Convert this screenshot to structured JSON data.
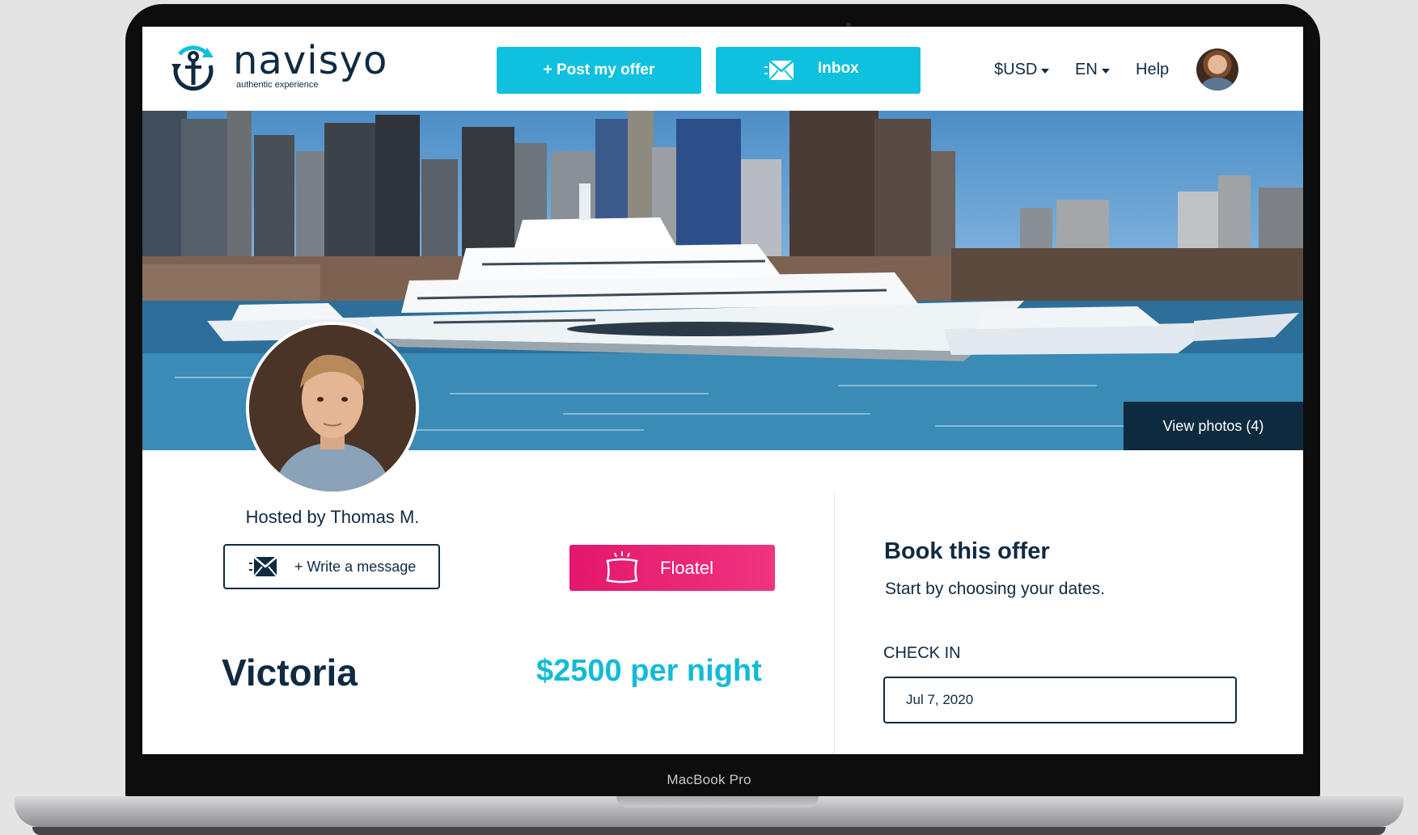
{
  "device": {
    "model_label": "MacBook Pro"
  },
  "brand": {
    "name": "navisyo",
    "tagline": "authentic experience",
    "colors": {
      "navy": "#102a43",
      "cyan": "#0fc1de",
      "pink": "#e3176d"
    }
  },
  "header": {
    "post_offer_label": "+ Post my offer",
    "inbox_label": "Inbox",
    "currency_label": "$USD",
    "language_label": "EN",
    "help_label": "Help"
  },
  "hero": {
    "view_photos_label": "View photos (4)"
  },
  "host": {
    "hosted_by_label": "Hosted by Thomas M.",
    "write_message_label": "+ Write a message"
  },
  "listing": {
    "type_label": "Floatel",
    "name": "Victoria",
    "price_label": "$2500 per night"
  },
  "booking": {
    "title": "Book this offer",
    "subtitle": "Start by choosing your dates.",
    "checkin_label": "CHECK IN",
    "checkin_value": "Jul 7, 2020"
  },
  "icons": {
    "logo": "anchor-icon",
    "inbox": "mail-icon",
    "message": "mail-icon",
    "floatel": "pillow-icon"
  }
}
